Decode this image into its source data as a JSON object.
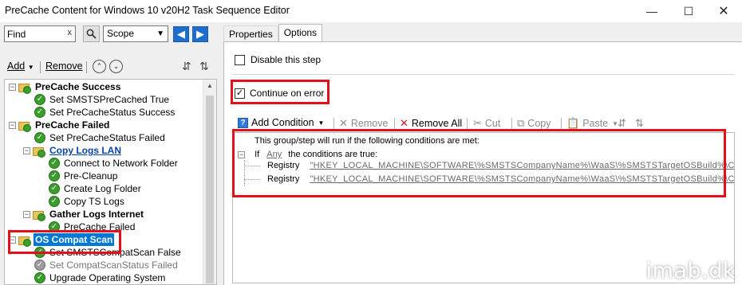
{
  "window": {
    "title": "PreCache Content for Windows 10 v20H2 Task Sequence Editor",
    "minimize_icon": "minimize-icon",
    "maximize_icon": "maximize-icon",
    "close_icon": "close-icon"
  },
  "left_toolbar": {
    "find_value": "Find",
    "scope_value": "Scope",
    "add_label": "Add",
    "remove_label": "Remove"
  },
  "tree": [
    {
      "label": "PreCache Success",
      "kind": "group"
    },
    {
      "label": "Set SMSTSPreCached True",
      "kind": "step"
    },
    {
      "label": "Set PreCacheStatus Success",
      "kind": "step"
    },
    {
      "label": "PreCache Failed",
      "kind": "group"
    },
    {
      "label": "Set PreCacheStatus Failed",
      "kind": "step"
    },
    {
      "label": "Copy Logs LAN",
      "kind": "group-link"
    },
    {
      "label": "Connect to Network Folder",
      "kind": "step"
    },
    {
      "label": "Pre-Cleanup",
      "kind": "step"
    },
    {
      "label": "Create Log Folder",
      "kind": "step"
    },
    {
      "label": "Copy TS Logs",
      "kind": "step"
    },
    {
      "label": "Gather Logs Internet",
      "kind": "group"
    },
    {
      "label": "PreCache Failed",
      "kind": "step"
    },
    {
      "label": "OS Compat Scan",
      "kind": "group-selected"
    },
    {
      "label": "Set SMSTSCompatScan False",
      "kind": "step"
    },
    {
      "label": "Set CompatScanStatus Failed",
      "kind": "step-disabled"
    },
    {
      "label": "Upgrade Operating System",
      "kind": "step"
    }
  ],
  "tabs": [
    {
      "label": "Properties",
      "active": false
    },
    {
      "label": "Options",
      "active": true
    }
  ],
  "options": {
    "disable_step_label": "Disable this step",
    "disable_step_checked": false,
    "continue_on_error_label": "Continue on error",
    "continue_on_error_checked": true
  },
  "condition_toolbar": {
    "add_condition": "Add Condition",
    "remove": "Remove",
    "remove_all": "Remove All",
    "cut": "Cut",
    "copy": "Copy",
    "paste": "Paste"
  },
  "conditions": {
    "header": "This group/step will run if the following conditions are met:",
    "if_label": "If",
    "any_label": "Any",
    "if_suffix": "the conditions are true:",
    "rows": [
      {
        "type": "Registry",
        "value": "\"HKEY_LOCAL_MACHINE\\SOFTWARE\\%SMSTSCompanyName%\\WaaS\\%SMSTSTargetOSBuild%\\Compa"
      },
      {
        "type": "Registry",
        "value": "\"HKEY_LOCAL_MACHINE\\SOFTWARE\\%SMSTSCompanyName%\\WaaS\\%SMSTSTargetOSBuild%\\Compa"
      }
    ]
  },
  "watermark": "imab.dk",
  "colors": {
    "highlight_red": "#e3101b",
    "selection_blue": "#0078d7",
    "step_green": "#3a9e2a"
  }
}
